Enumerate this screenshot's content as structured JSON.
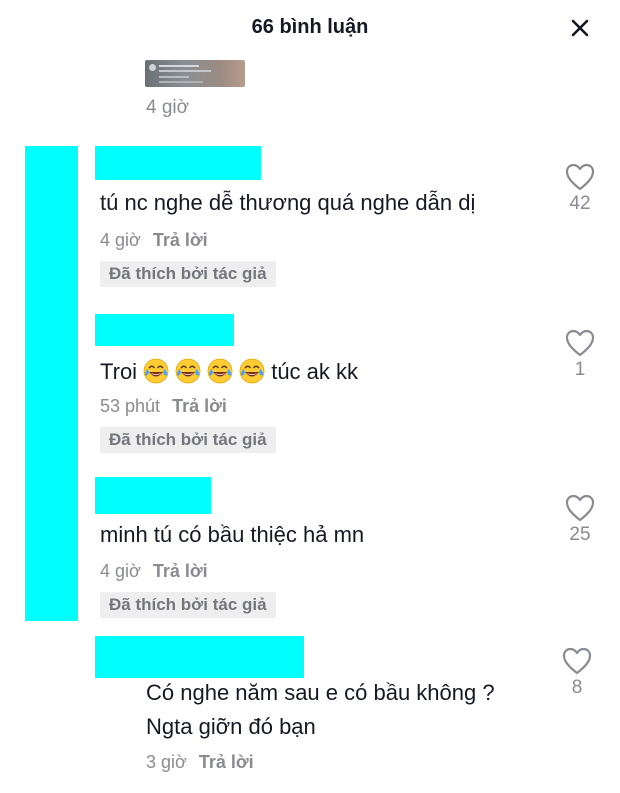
{
  "header": {
    "title": "66 bình luận",
    "close_icon": "close-icon"
  },
  "top_comment": {
    "time": "4 giờ"
  },
  "comments": [
    {
      "text": "tú nc nghe dễ thương quá nghe dẫn dị",
      "time": "4 giờ",
      "reply": "Trả lời",
      "badge": "Đã thích bởi tác giả",
      "likes": "42"
    },
    {
      "text_prefix": "Troi",
      "emoji": "face-with-tears-of-joy",
      "emoji_count": 4,
      "text_suffix": "túc ak kk",
      "time": "53 phút",
      "reply": "Trả lời",
      "badge": "Đã thích bởi tác giả",
      "likes": "1"
    },
    {
      "text": "minh tú có bầu thiệc hả mn",
      "time": "4 giờ",
      "reply": "Trả lời",
      "badge": "Đã thích bởi tác giả",
      "likes": "25"
    },
    {
      "text_line1": "Có nghe năm sau e có bầu không ?",
      "text_line2": "Ngta giỡn đó bạn",
      "time": "3 giờ",
      "reply": "Trả lời",
      "likes": "8"
    }
  ],
  "colors": {
    "redaction": "#00ffff",
    "text": "#161823",
    "muted": "#8a8b91",
    "badge_bg": "#eeeeef"
  }
}
